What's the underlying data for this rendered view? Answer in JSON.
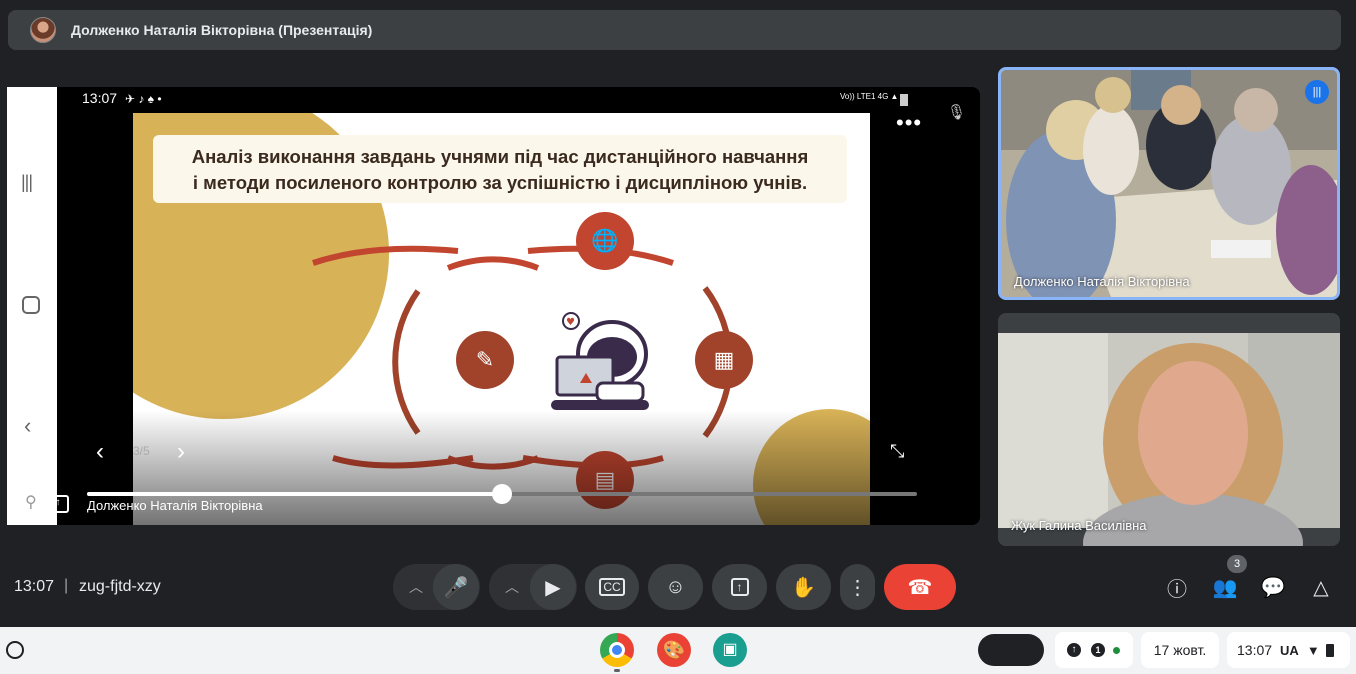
{
  "meeting": {
    "header_title": "Долженко Наталія Вікторівна (Презентація)",
    "time": "13:07",
    "separator": "|",
    "code": "zug-fjtd-xzy"
  },
  "phone_status": {
    "time": "13:07",
    "icons": "✈ ♪ ♠ •",
    "signal": "Vo)) LTE1 4G ▲▼"
  },
  "slide": {
    "title_line1": "Аналіз виконання завдань учнями під час дистанційного навчання",
    "title_line2": "і методи посиленого контролю за успішністю і дисципліною учнів.",
    "page": "3/5",
    "colors": {
      "gold": "#d8b257",
      "rust": "#c2452f",
      "brown": "#a0432a"
    }
  },
  "presenter_label": "Долженко Наталія Вікторівна",
  "progress_fraction": 0.5,
  "tiles": [
    {
      "name": "Долженко Наталія Вікторівна"
    },
    {
      "name": "Жук Галина Василівна"
    }
  ],
  "people_count": "3",
  "shelf": {
    "status_count": "1",
    "date": "17 жовт.",
    "time": "13:07",
    "lang": "UA"
  },
  "accent": {
    "end_call": "#ea4335",
    "speaking": "#1a73e8",
    "highlight": "#8ab4f8"
  }
}
